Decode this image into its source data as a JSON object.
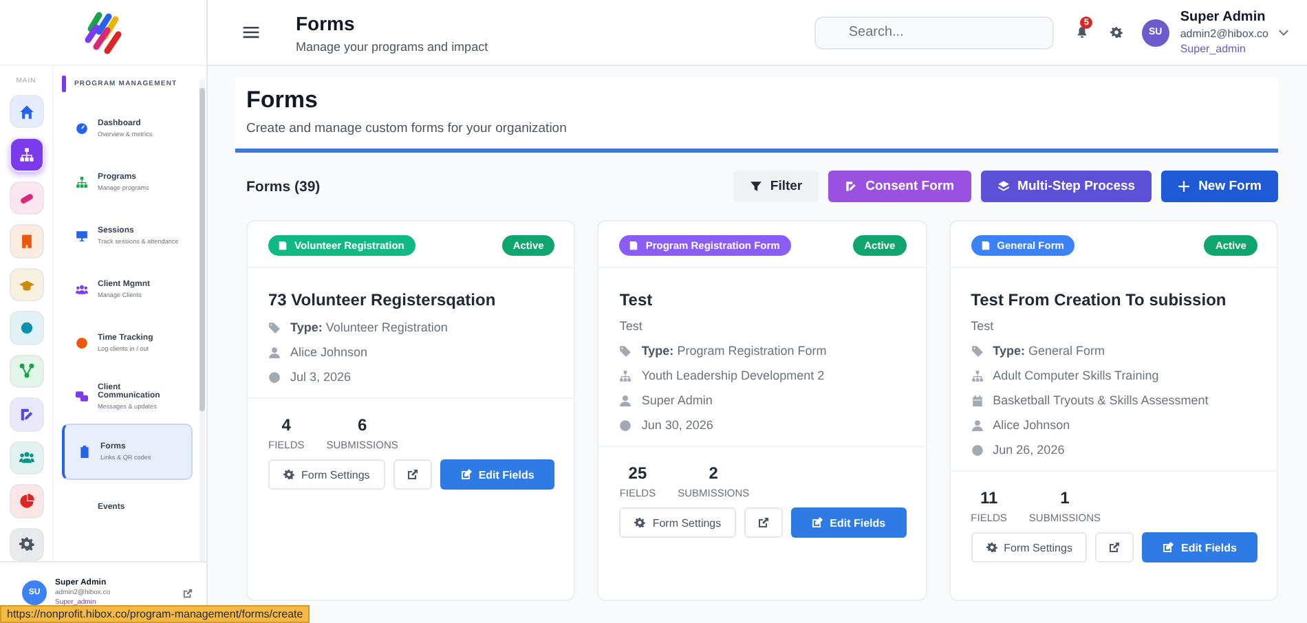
{
  "header": {
    "title": "Forms",
    "subtitle": "Manage your programs and impact",
    "search": {
      "placeholder": "Search..."
    },
    "notifications": "5",
    "user": {
      "initials": "SU",
      "name": "Super Admin",
      "email": "admin2@hibox.co",
      "role": "Super_admin"
    }
  },
  "rail": {
    "label": "MAIN",
    "items": [
      {
        "kind": "home",
        "color": "#2563eb",
        "selected": false
      },
      {
        "kind": "sitemap",
        "color": "#7c3aed",
        "selected": true
      },
      {
        "kind": "pill",
        "color": "#db2777",
        "selected": false
      },
      {
        "kind": "building",
        "color": "#ea580c",
        "selected": false
      },
      {
        "kind": "cap",
        "color": "#ca8a04",
        "selected": false
      },
      {
        "kind": "dot",
        "color": "#0891b2",
        "selected": false
      },
      {
        "kind": "nodes",
        "color": "#16a34a",
        "selected": false
      },
      {
        "kind": "edit",
        "color": "#4f46e5",
        "selected": false
      },
      {
        "kind": "users",
        "color": "#0d9488",
        "selected": false
      },
      {
        "kind": "chart",
        "color": "#dc2626",
        "selected": false
      },
      {
        "kind": "gear",
        "color": "#4b5563",
        "selected": false
      }
    ]
  },
  "nav": {
    "section": "PROGRAM MANAGEMENT",
    "items": [
      {
        "kind": "dashboard",
        "title": "Dashboard",
        "subtitle": "Overview & metrics",
        "selected": false
      },
      {
        "kind": "programs",
        "title": "Programs",
        "subtitle": "Manage programs",
        "selected": false
      },
      {
        "kind": "sessions",
        "title": "Sessions",
        "subtitle": "Track sessions & attendance",
        "selected": false
      },
      {
        "kind": "clients",
        "title": "Client Mgmnt",
        "subtitle": "Manage Clients",
        "selected": false
      },
      {
        "kind": "time",
        "title": "Time Tracking",
        "subtitle": "Log clients in / out",
        "selected": false
      },
      {
        "kind": "chat",
        "title": "Client Communication",
        "subtitle": "Messages & updates",
        "selected": false
      },
      {
        "kind": "forms",
        "title": "Forms",
        "subtitle": "Links & QR codes",
        "selected": true
      },
      {
        "kind": "events",
        "title": "Events",
        "selected": false
      }
    ]
  },
  "sidebar_user": {
    "initials": "SU",
    "name": "Super Admin",
    "email": "admin2@hibox.co",
    "role": "Super_admin"
  },
  "page": {
    "title": "Forms",
    "subtitle": "Create and manage custom forms for your organization"
  },
  "toolbar": {
    "count": "Forms (39)",
    "buttons": [
      {
        "kind": "filter",
        "label": "Filter"
      },
      {
        "kind": "consent",
        "label": "Consent Form"
      },
      {
        "kind": "multistep",
        "label": "Multi-Step Process"
      },
      {
        "kind": "new",
        "label": "New Form"
      }
    ]
  },
  "cards": [
    {
      "badge": "Volunteer Registration",
      "color": "#10b981",
      "status": "Active",
      "title": "73 Volunteer Registersqation",
      "meta": [
        {
          "kind": "type",
          "label": "Type:",
          "text": "Volunteer Registration"
        },
        {
          "kind": "user",
          "text": "Alice Johnson"
        },
        {
          "kind": "date",
          "text": "Jul 3, 2026"
        }
      ],
      "fields": "4",
      "fields_label": "FIELDS",
      "submissions": "6",
      "submissions_label": "SUBMISSIONS",
      "settings": "Form Settings",
      "edit": "Edit Fields"
    },
    {
      "badge": "Program Registration Form",
      "color": "#8b5cf6",
      "status": "Active",
      "title": "Test",
      "description": "Test",
      "meta": [
        {
          "kind": "type",
          "label": "Type:",
          "text": "Program Registration Form"
        },
        {
          "kind": "program",
          "text": "Youth Leadership Development 2"
        },
        {
          "kind": "user",
          "text": "Super Admin"
        },
        {
          "kind": "date",
          "text": "Jun 30, 2026"
        }
      ],
      "fields": "25",
      "fields_label": "FIELDS",
      "submissions": "2",
      "submissions_label": "SUBMISSIONS",
      "settings": "Form Settings",
      "edit": "Edit Fields"
    },
    {
      "badge": "General Form",
      "color": "#3b82f6",
      "status": "Active",
      "title": "Test From Creation To subission",
      "description": "Test",
      "meta": [
        {
          "kind": "type",
          "label": "Type:",
          "text": "General Form"
        },
        {
          "kind": "program",
          "text": "Adult Computer Skills Training"
        },
        {
          "kind": "event",
          "text": "Basketball Tryouts & Skills Assessment"
        },
        {
          "kind": "user",
          "text": "Alice Johnson"
        },
        {
          "kind": "date",
          "text": "Jun 26, 2026"
        }
      ],
      "fields": "11",
      "fields_label": "FIELDS",
      "submissions": "1",
      "submissions_label": "SUBMISSIONS",
      "settings": "Form Settings",
      "edit": "Edit Fields"
    }
  ],
  "status_url": "https://nonprofit.hibox.co/program-management/forms/create"
}
